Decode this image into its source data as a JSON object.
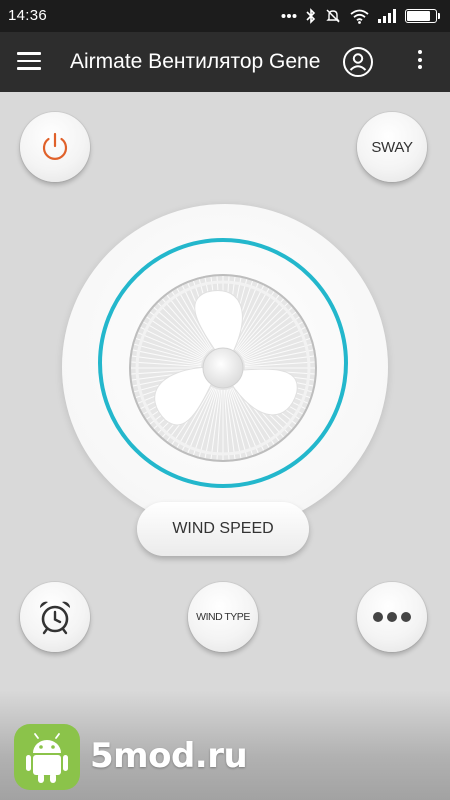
{
  "status_bar": {
    "time": "14:36",
    "battery_percent": 85,
    "icons": [
      "dots-icon",
      "bluetooth-icon",
      "mute-icon",
      "wifi-icon",
      "signal-icon",
      "battery-icon"
    ]
  },
  "app_bar": {
    "title": "Airmate Вентилятор Gene",
    "menu_icon": "hamburger-menu-icon",
    "account_icon": "account-circle-icon",
    "more_icon": "more-vert-icon"
  },
  "controls": {
    "power_icon": "power-icon",
    "sway_label": "SWAY",
    "wind_speed_label": "WIND SPEED",
    "timer_icon": "alarm-clock-icon",
    "wind_type_label": "WIND TYPE",
    "more_icon": "more-dots-icon"
  },
  "colors": {
    "accent_ring": "#23b7cc",
    "power": "#e0612a",
    "app_bar": "#2d2d2d",
    "status_bar": "#1c1c1c",
    "background": "#d9d9d9"
  },
  "watermark": {
    "text": "5mod.ru",
    "logo_icon": "android-robot-icon"
  }
}
